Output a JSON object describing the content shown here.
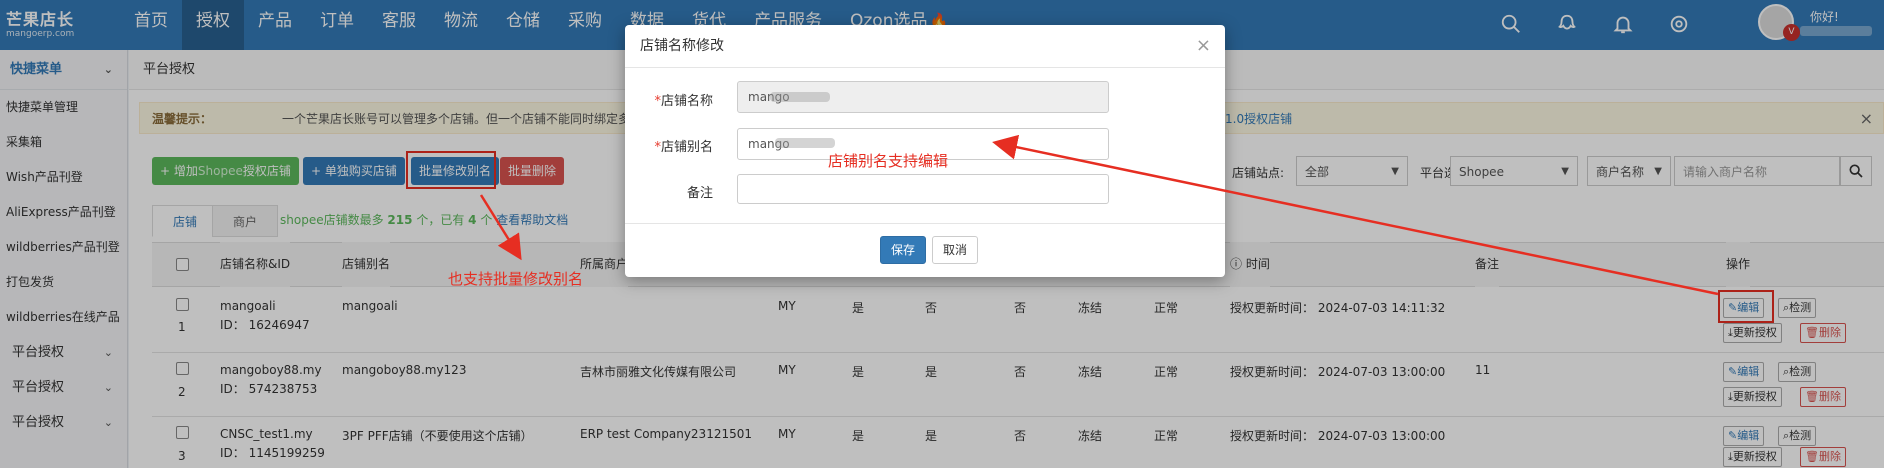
{
  "brand": {
    "name": "芒果店长",
    "sub": "mangoerp.com"
  },
  "nav": [
    "首页",
    "授权",
    "产品",
    "订单",
    "客服",
    "物流",
    "仓储",
    "采购",
    "数据",
    "货代",
    "产品服务",
    "Ozon选品"
  ],
  "nav_hot_mark": "🔥",
  "header": {
    "greeting": "你好!",
    "badge": "V"
  },
  "sidebar": {
    "head": "快捷菜单",
    "items": [
      "快捷菜单管理",
      "采集箱",
      "Wish产品刊登",
      "AliExpress产品刊登",
      "wildberries产品刊登",
      "打包发货",
      "wildberries在线产品"
    ],
    "groups": [
      "平台授权",
      "平台授权",
      "平台授权"
    ]
  },
  "breadcrumb": "平台授权",
  "tip": {
    "title": "温馨提示：",
    "text": "一个芒果店长账号可以管理多个店铺。但一个店铺不能同时绑定多个芒果店长",
    "link": "1.0授权店铺",
    "close": "×"
  },
  "toolbar": {
    "add_pre": "增加",
    "add_highlight": "Shopee",
    "add_post": "授权店铺",
    "single_buy": "单独购买店铺",
    "batch_alias": "批量修改别名",
    "batch_delete": "批量删除"
  },
  "filters": {
    "site_label": "店铺站点:",
    "site_value": "全部",
    "platform_label": "平台选择:",
    "platform_value": "Shopee",
    "merchant_select": "商户名称",
    "merchant_placeholder": "请输入商户名称"
  },
  "tabs": [
    "店铺",
    "商户"
  ],
  "tab_note": {
    "pre": "shopee店铺数最多",
    "max": "215",
    "mid": "个，已有",
    "count": "4",
    "post": "个",
    "link": "查看帮助文档"
  },
  "table": {
    "headers": [
      "店铺名称&ID",
      "店铺别名",
      "所属商户",
      "时间",
      "备注",
      "操作"
    ],
    "rows": [
      {
        "index": "1",
        "name": "mangoali",
        "id": "ID： 16246947",
        "alias": "mangoali",
        "merchant": "",
        "site": "MY",
        "c1": "是",
        "c2": "否",
        "c3": "否",
        "freeze": "冻结",
        "status": "正常",
        "time": "授权更新时间： 2024-07-03 14:11:32",
        "remark": ""
      },
      {
        "index": "2",
        "name": "mangoboy88.my",
        "id": "ID： 574238753",
        "alias": "mangoboy88.my123",
        "merchant": "吉林市丽雅文化传媒有限公司",
        "site": "MY",
        "c1": "是",
        "c2": "是",
        "c3": "否",
        "freeze": "冻结",
        "status": "正常",
        "time": "授权更新时间： 2024-07-03 13:00:00",
        "remark": "11"
      },
      {
        "index": "3",
        "name": "CNSC_test1.my",
        "id": "ID： 1145199259",
        "alias": "3PF PFF店铺（不要使用这个店铺）",
        "merchant": "ERP test Company23121501",
        "site": "MY",
        "c1": "是",
        "c2": "是",
        "c3": "否",
        "freeze": "冻结",
        "status": "正常",
        "time": "授权更新时间： 2024-07-03 13:00:00",
        "remark": ""
      }
    ],
    "ops": {
      "edit": "编辑",
      "check": "检测",
      "reauth": "更新授权",
      "delete": "删除"
    }
  },
  "modal": {
    "title": "店铺名称修改",
    "close": "×",
    "name_label": "店铺名称",
    "name_value": "mango",
    "alias_label": "店铺别名",
    "alias_value": "mango",
    "remark_label": "备注",
    "save": "保存",
    "cancel": "取消",
    "required_mark": "*"
  },
  "annotations": {
    "alias_editable": "店铺别名支持编辑",
    "batch_alias": "也支持批量修改别名"
  },
  "colors": {
    "primary": "#337ab7",
    "annotation": "#e62e22",
    "success": "#5cb85c",
    "danger": "#d9534f"
  }
}
